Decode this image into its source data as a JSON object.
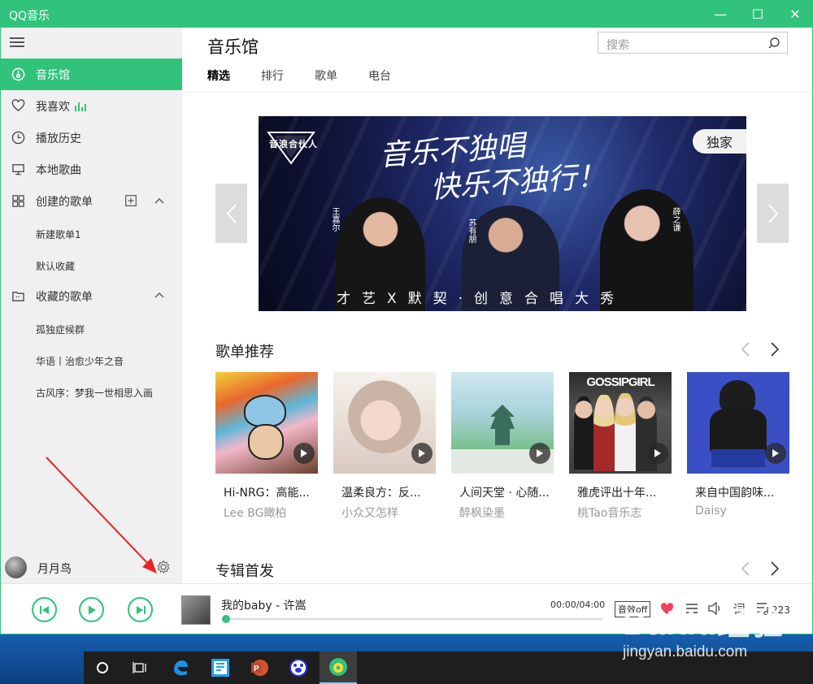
{
  "window": {
    "title": "QQ音乐",
    "min_glyph": "—",
    "max_glyph": "☐",
    "close_glyph": "✕"
  },
  "sidebar": {
    "items": [
      {
        "label": "音乐馆",
        "icon": "music-disc-icon",
        "active": true
      },
      {
        "label": "我喜欢",
        "icon": "heart-icon"
      },
      {
        "label": "播放历史",
        "icon": "clock-icon"
      },
      {
        "label": "本地歌曲",
        "icon": "monitor-icon"
      },
      {
        "label": "创建的歌单",
        "icon": "grid-icon"
      }
    ],
    "created_playlists": [
      "新建歌单1",
      "默认收藏"
    ],
    "collected_title": "收藏的歌单",
    "collected_playlists": [
      "孤独症候群",
      "华语丨治愈少年之音",
      "古风序：梦我一世相思入画"
    ],
    "username": "月月鸟"
  },
  "main": {
    "title": "音乐馆",
    "search_placeholder": "搜索",
    "tabs": [
      "精选",
      "排行",
      "歌单",
      "电台"
    ],
    "banner": {
      "logo_text": "音浪合伙人",
      "slogan_line1": "音乐不独唱",
      "slogan_line2": "快乐不独行！",
      "badge": "独家",
      "names": [
        "王嘉尔",
        "苏有朋",
        "薛之谦"
      ],
      "bottom_text": "才艺X默契·创意合唱大秀"
    },
    "playlist_section_title": "歌单推荐",
    "playlists": [
      {
        "title": "Hi-NRG：高能...",
        "author": "Lee BG瞰柏"
      },
      {
        "title": "温柔良方：反...",
        "author": "小众又怎样"
      },
      {
        "title": "人间天堂 · 心随...",
        "author": "醉枫染墨"
      },
      {
        "title": "雅虎评出十年...",
        "author": "桃Tao音乐志"
      },
      {
        "title": "来自中国韵味...",
        "author": "Daisy"
      }
    ],
    "album_section_title": "专辑首发",
    "cover4_text": "GOSSIPGIRL"
  },
  "player": {
    "song": "我的baby - 许嵩",
    "time": "00:00/04:00",
    "progress": 0,
    "effect_label": "音效off",
    "lyrics_label": "词",
    "queue_count": "223"
  },
  "watermark": {
    "main": "Baidu经验",
    "sub": "jingyan.baidu.com"
  },
  "colors": {
    "accent": "#31c27c",
    "like": "#f0425a"
  }
}
